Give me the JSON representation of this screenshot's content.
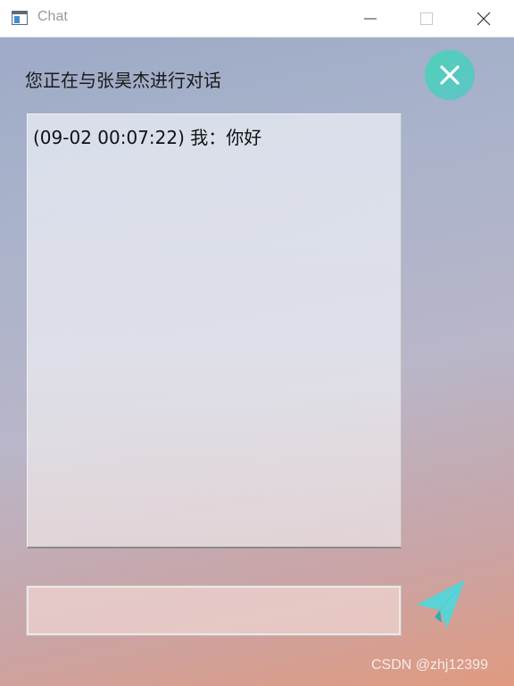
{
  "window": {
    "title": "Chat",
    "icon": "app-window-icon",
    "controls": [
      "minimize-icon",
      "maximize-icon",
      "close-icon"
    ]
  },
  "chat": {
    "heading": "您正在与张昊杰进行对话",
    "close_icon": "close-icon",
    "messages": [
      {
        "text": "(09-02 00:07:22) 我：你好"
      }
    ],
    "input": {
      "value": "",
      "placeholder": ""
    },
    "send_icon": "paper-plane-icon"
  },
  "watermark": "CSDN @zhj12399",
  "colors": {
    "accent_teal": "#4fd1b6",
    "send_icon": "#5ad3d6",
    "gradient_top": "#9eaac6",
    "gradient_bottom": "#e09a80"
  }
}
